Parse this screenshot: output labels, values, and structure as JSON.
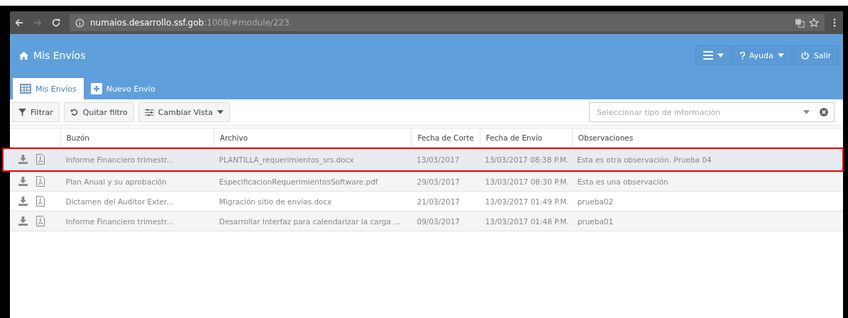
{
  "browser": {
    "url_host": "numaios.desarrollo.ssf.gob",
    "url_path": ":1008/#module/223"
  },
  "header": {
    "title": "Mis Envíos",
    "buttons": [
      {
        "kind": "menu"
      },
      {
        "kind": "help",
        "label": "Ayuda"
      },
      {
        "kind": "exit",
        "label": "Salir"
      }
    ]
  },
  "tabs": [
    {
      "label": "Mis Envíos",
      "kind": "grid",
      "selected": true
    },
    {
      "label": "Nuevo Envío",
      "kind": "plus",
      "selected": false
    }
  ],
  "toolbar": {
    "buttons": [
      {
        "kind": "filter",
        "label": "Filtrar"
      },
      {
        "kind": "undo",
        "label": "Quitar filtro"
      },
      {
        "kind": "view",
        "label": "Cambiar Vista"
      }
    ],
    "select": {
      "placeholder": "Seleccionar tipo de información"
    }
  },
  "table": {
    "columns": [
      "Buzón",
      "Archivo",
      "Fecha de Corte",
      "Fecha de Envío",
      "Observaciones"
    ],
    "rows": [
      {
        "selected": true,
        "cells": [
          "Informe Financiero trimestr...",
          "PLANTILLA_requerimientos_srs.docx",
          "13/03/2017",
          "13/03/2017 08:38 P.M.",
          "Esta es otra observación. Prueba 04"
        ]
      },
      {
        "selected": false,
        "cells": [
          "Plan Anual y su aprobación",
          "EspecificacionRequerimientosSoftware.pdf",
          "29/03/2017",
          "13/03/2017 08:30 P.M.",
          "Esta es una observación"
        ]
      },
      {
        "selected": false,
        "cells": [
          "Dictamen del Auditor Exter...",
          "Migración sitio de envíos.docx",
          "21/03/2017",
          "13/03/2017 01:49 P.M.",
          "prueba02"
        ]
      },
      {
        "selected": false,
        "cells": [
          "Informe Financiero trimestr...",
          "Desarrollar Interfaz para calendarizar la carga ...",
          "09/03/2017",
          "13/03/2017 01:48 P.M.",
          "prueba01"
        ]
      }
    ]
  }
}
